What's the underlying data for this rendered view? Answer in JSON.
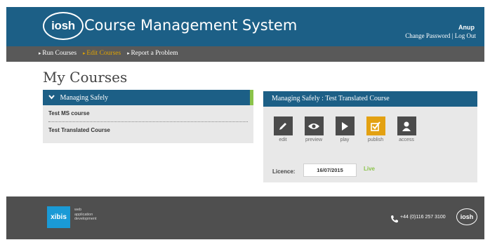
{
  "header": {
    "logo_text": "iosh",
    "title": "Course Management System",
    "user_name": "Anup",
    "change_password": "Change Password",
    "separator": " | ",
    "log_out": "Log Out"
  },
  "nav": {
    "items": [
      {
        "label": "Run Courses",
        "active": false
      },
      {
        "label": "Edit Courses",
        "active": true
      },
      {
        "label": "Report a Problem",
        "active": false
      }
    ]
  },
  "main": {
    "page_title": "My Courses",
    "course_group": {
      "name": "Managing Safely",
      "courses": [
        "Test MS course",
        "Test Translated Course"
      ]
    },
    "detail": {
      "title": "Managing Safely : Test Translated Course",
      "tools": [
        {
          "label": "edit",
          "icon": "pencil-icon"
        },
        {
          "label": "preview",
          "icon": "eye-icon"
        },
        {
          "label": "play",
          "icon": "play-icon"
        },
        {
          "label": "publish",
          "icon": "checkbox-icon"
        },
        {
          "label": "access",
          "icon": "user-icon"
        }
      ],
      "licence_label": "Licence:",
      "licence_date": "16/07/2015",
      "licence_status": "Live"
    }
  },
  "footer": {
    "brand": "xibis",
    "tagline": [
      "web",
      "application",
      "development"
    ],
    "phone": "+44 (0)116 257 3100",
    "logo_text": "iosh"
  },
  "colors": {
    "header_blue": "#1c5f86",
    "nav_grey": "#595959",
    "active_nav": "#e2a400",
    "live_green": "#8bc34a",
    "footer_grey": "#4f4f4f",
    "xibis_blue": "#1a9ad6"
  }
}
